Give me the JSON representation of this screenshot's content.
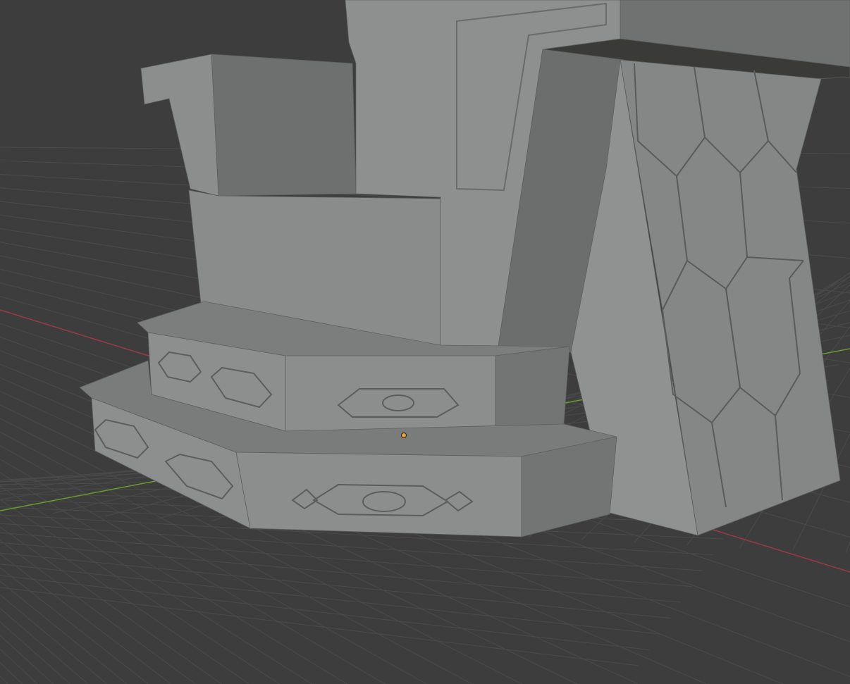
{
  "viewport": {
    "background_color": "#3d3d3d",
    "grid_color": "#4a4a4a",
    "x_axis_color": "#9b3a44",
    "y_axis_color": "#6a9a2c",
    "origin_color": "#f0a030"
  },
  "model": {
    "light_face": "#8e9090",
    "mid_face": "#7a7b7b",
    "dark_face": "#6c6d6d",
    "shadow": "#3a3a38"
  }
}
